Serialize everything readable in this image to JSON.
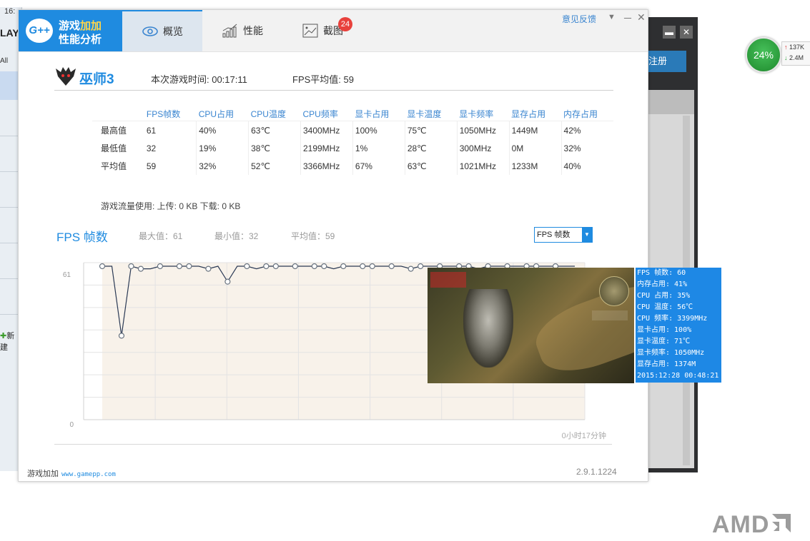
{
  "background_app": {
    "time_fragment": "16:",
    "play_fragment": "LAY",
    "all_fragment": "All",
    "new_fragment": "新建",
    "register_label": "注册"
  },
  "net_widget": {
    "percent": "24%",
    "upload": "137K",
    "download": "2.4M"
  },
  "amd_logo": "AMD",
  "window": {
    "logo_line1_a": "游戏",
    "logo_line1_b": "加加",
    "logo_line2": "性能分析",
    "logo_badge": "G++",
    "tabs": [
      {
        "label": "概览",
        "icon": "eye-icon"
      },
      {
        "label": "性能",
        "icon": "bar-chart-icon"
      },
      {
        "label": "截图",
        "icon": "image-icon",
        "badge": "24"
      }
    ],
    "feedback": "意见反馈",
    "controls": {
      "menu": "▼",
      "minimize": "－",
      "close": "✕"
    }
  },
  "game": {
    "name": "巫师3",
    "session_time": "本次游戏时间: 00:17:11",
    "fps_avg": "FPS平均值: 59"
  },
  "stats_table": {
    "headers": [
      "FPS帧数",
      "CPU占用",
      "CPU温度",
      "CPU频率",
      "显卡占用",
      "显卡温度",
      "显卡频率",
      "显存占用",
      "内存占用"
    ],
    "rows": [
      {
        "label": "最高值",
        "values": [
          "61",
          "40%",
          "63℃",
          "3400MHz",
          "100%",
          "75℃",
          "1050MHz",
          "1449M",
          "42%"
        ]
      },
      {
        "label": "最低值",
        "values": [
          "32",
          "19%",
          "38℃",
          "2199MHz",
          "1%",
          "28℃",
          "300MHz",
          "0M",
          "32%"
        ]
      },
      {
        "label": "平均值",
        "values": [
          "59",
          "32%",
          "52℃",
          "3366MHz",
          "67%",
          "63℃",
          "1021MHz",
          "1233M",
          "40%"
        ]
      }
    ]
  },
  "traffic": "游戏流量使用: 上传: 0 KB    下载: 0 KB",
  "fps_section": {
    "title": "FPS 帧数",
    "max": "最大值：61",
    "min": "最小值：32",
    "avg": "平均值：59",
    "select_value": "FPS 帧数"
  },
  "chart_data": {
    "type": "line",
    "title": "",
    "ylim": [
      0,
      61
    ],
    "ytick_labels": [
      "61",
      "0"
    ],
    "x_end_label": "0小时17分钟",
    "grid": true,
    "series": [
      {
        "values": [
          61,
          61,
          34,
          61,
          60,
          60,
          61,
          61,
          61,
          61,
          61,
          60,
          61,
          55,
          61,
          61,
          60,
          61,
          61,
          61,
          61,
          61,
          61,
          61,
          60,
          61,
          61,
          61,
          61,
          61,
          61,
          61,
          60,
          61,
          61,
          61,
          61,
          61,
          61,
          60,
          61,
          61,
          61,
          61,
          61,
          61,
          61,
          61,
          61,
          61
        ]
      }
    ]
  },
  "screenshot_overlay": {
    "lines": [
      "FPS 帧数: 60",
      "内存占用: 41%",
      "CPU 占用: 35%",
      "CPU 温度: 56℃",
      "CPU 频率: 3399MHz",
      "显卡占用: 100%",
      "显卡温度: 71℃",
      "显卡频率: 1050MHz",
      "显存占用: 1374M",
      "2015:12:28 00:48:21"
    ]
  },
  "footer": {
    "brand": "游戏加加",
    "url": "www.gamepp.com",
    "version": "2.9.1.1224"
  },
  "colors": {
    "accent": "#1f8be0",
    "badge": "#e8413c",
    "chart_fill": "#f8f2ea",
    "osd_bg": "#1e88e5"
  }
}
